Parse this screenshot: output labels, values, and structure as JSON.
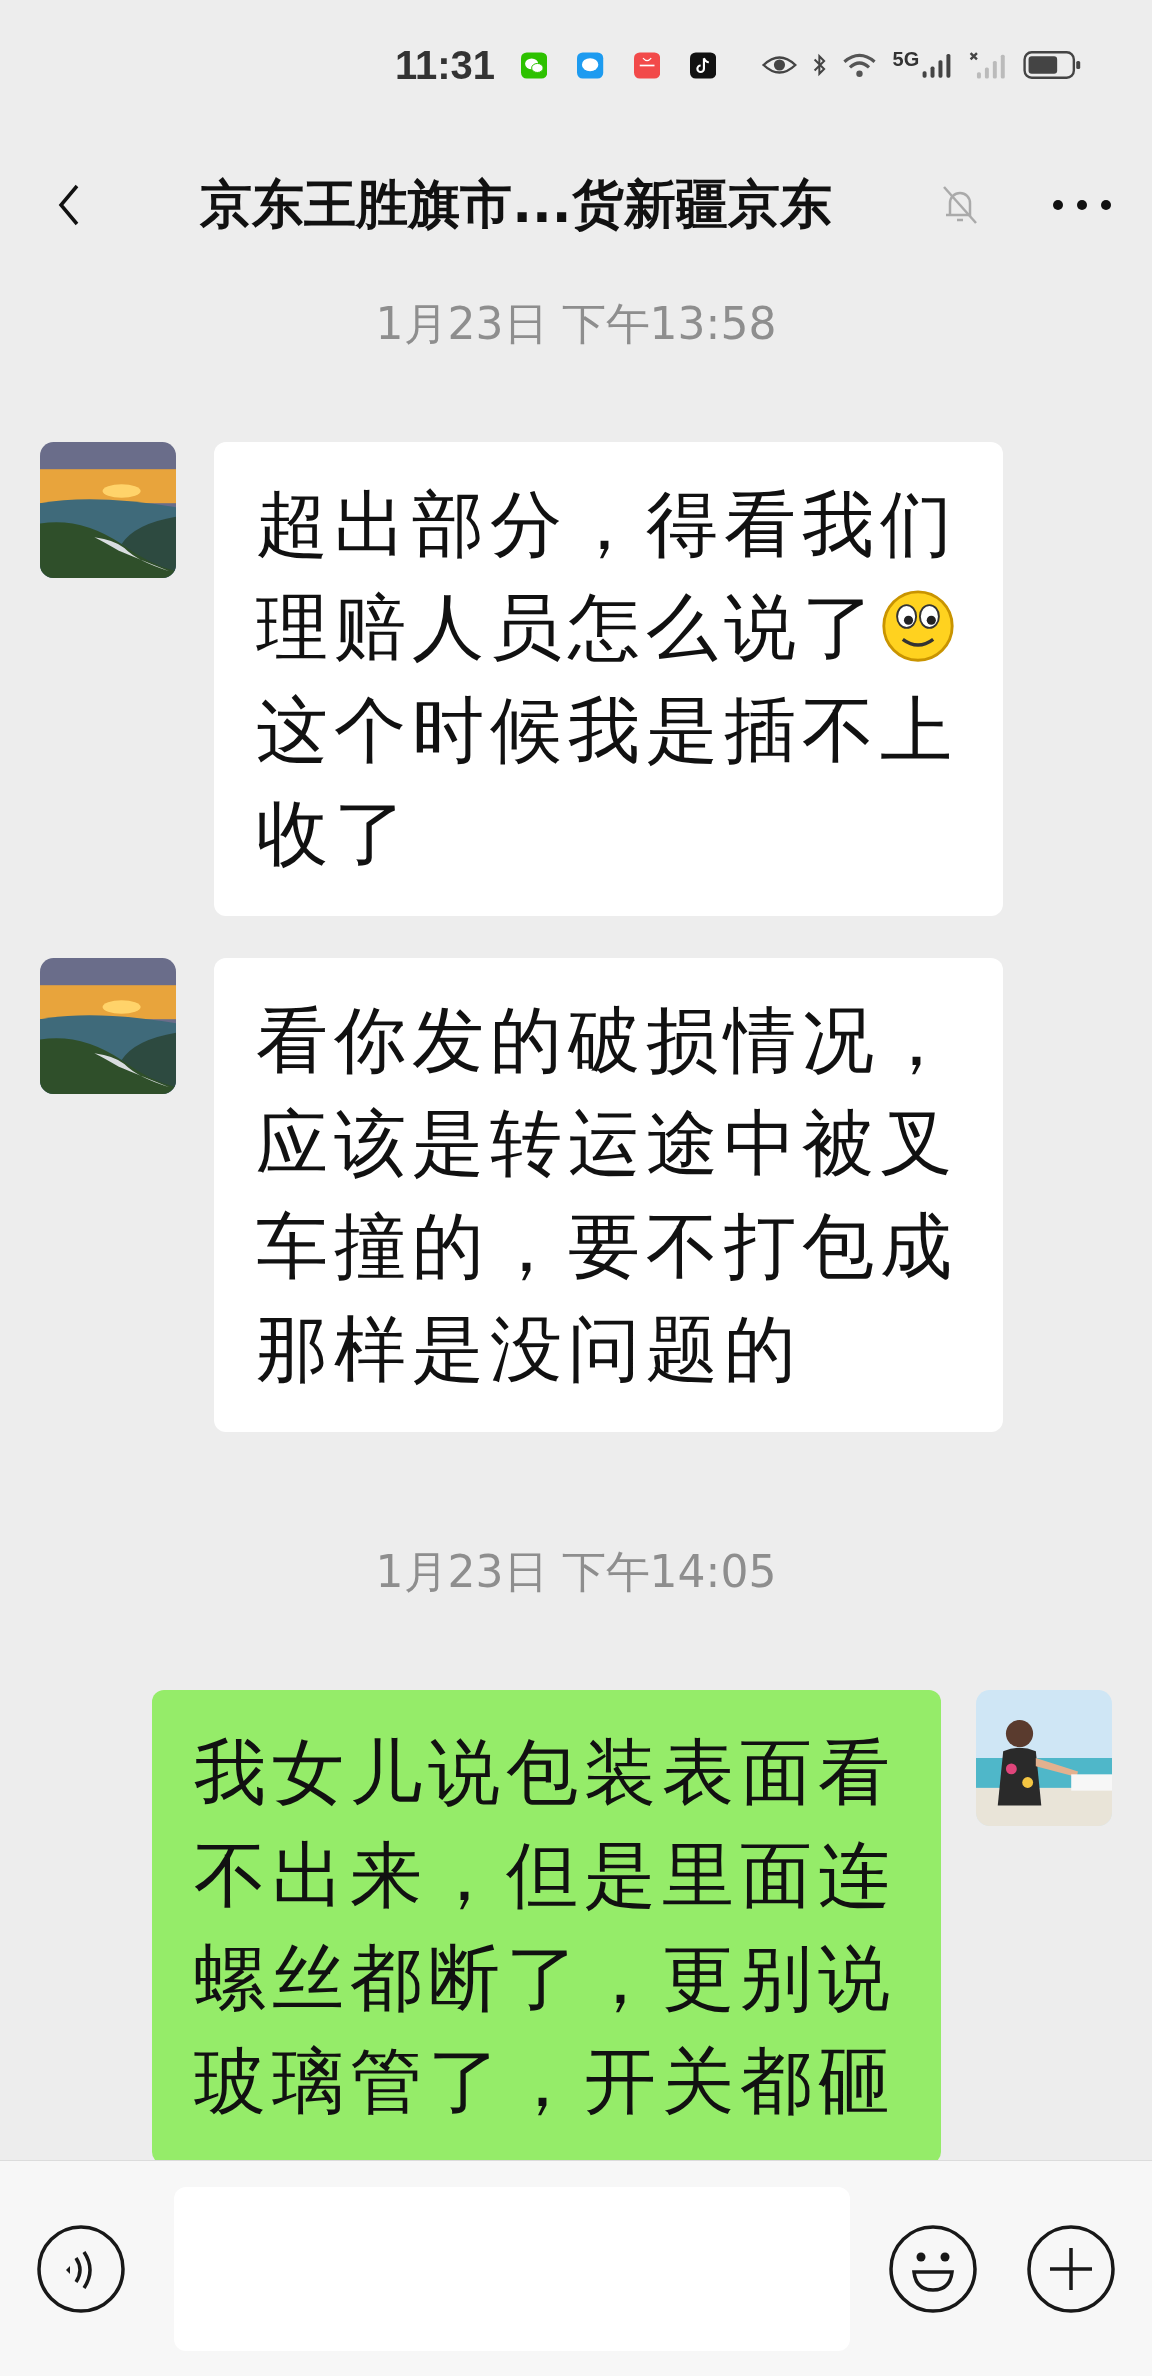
{
  "status_bar": {
    "time": "11:31",
    "network": "5G"
  },
  "header": {
    "title": "京东王胜旗市...货新疆京东",
    "muted": true
  },
  "messages": [
    {
      "kind": "time",
      "text": "1月23日 下午13:58"
    },
    {
      "kind": "message",
      "outgoing": false,
      "segments": [
        {
          "kind": "text",
          "text": "超出部分，得看我们理赔人员怎么说了"
        },
        {
          "kind": "emoji"
        },
        {
          "kind": "text",
          "text": "这个时候我是插不上收了"
        }
      ]
    },
    {
      "kind": "message",
      "outgoing": false,
      "segments": [
        {
          "kind": "text",
          "text": "看你发的破损情况，应该是转运途中被叉车撞的，要不打包成那样是没问题的"
        }
      ]
    },
    {
      "kind": "time",
      "text": "1月23日 下午14:05"
    },
    {
      "kind": "message",
      "outgoing": true,
      "segments": [
        {
          "kind": "text",
          "text": "我女儿说包装表面看不出来，但是里面连螺丝都断了，更别说玻璃管了，开关都砸"
        }
      ]
    }
  ]
}
